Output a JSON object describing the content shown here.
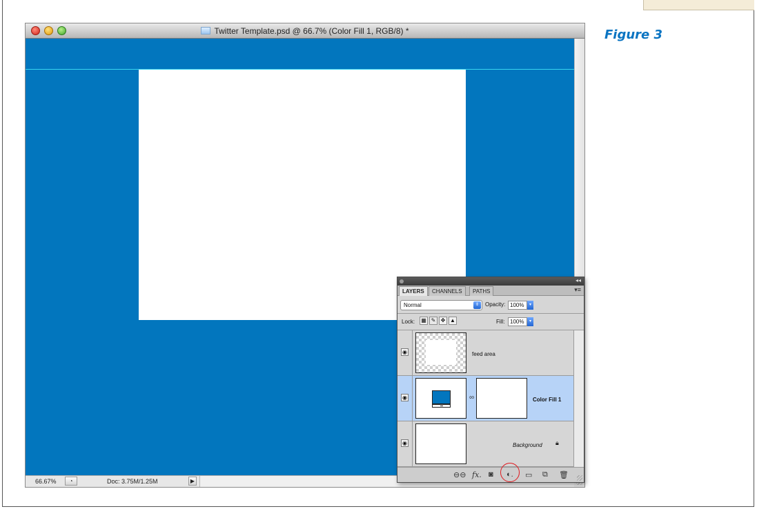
{
  "figure_label": "Figure 3",
  "window": {
    "title": "Twitter Template.psd @ 66.7% (Color Fill 1, RGB/8) *",
    "canvas_color": "#0276be"
  },
  "status_bar": {
    "zoom": "66.67%",
    "doc_info": "Doc: 3.75M/1.25M"
  },
  "layers_panel": {
    "tabs": [
      {
        "label": "LAYERS",
        "active": true
      },
      {
        "label": "CHANNELS",
        "active": false
      },
      {
        "label": "PATHS",
        "active": false
      }
    ],
    "blend_mode": "Normal",
    "opacity_label": "Opacity:",
    "opacity_value": "100%",
    "lock_label": "Lock:",
    "fill_label": "Fill:",
    "fill_value": "100%",
    "layers": [
      {
        "name": "feed area",
        "thumbnail": "transparent-checker",
        "visible": true,
        "selected": false
      },
      {
        "name": "Color Fill 1",
        "thumbnail": "color-fill",
        "has_mask": true,
        "visible": true,
        "selected": true
      },
      {
        "name": "Background",
        "thumbnail": "white",
        "visible": true,
        "selected": false,
        "locked": true
      }
    ],
    "footer_icons": [
      "link-layers-icon",
      "fx-icon",
      "add-mask-icon",
      "new-adjustment-layer-icon",
      "new-group-icon",
      "new-layer-icon",
      "trash-icon"
    ],
    "highlighted_icon": "new-adjustment-layer-icon"
  }
}
